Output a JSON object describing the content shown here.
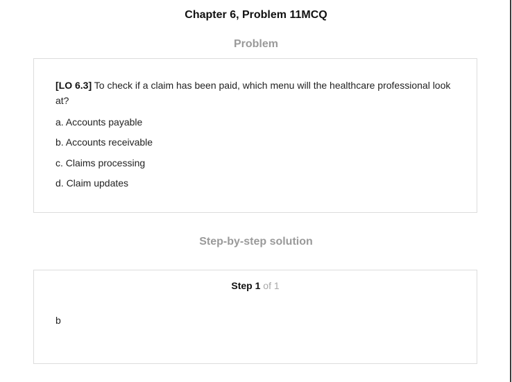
{
  "header": {
    "title": "Chapter 6, Problem 11MCQ"
  },
  "problem": {
    "heading": "Problem",
    "lo_tag": "[LO 6.3]",
    "question_text": " To check if a claim has been paid, which menu will the healthcare professional look at?",
    "options": [
      "a. Accounts payable",
      "b. Accounts receivable",
      "c. Claims processing",
      "d. Claim updates"
    ]
  },
  "solution": {
    "heading": "Step-by-step solution",
    "step_word": "Step",
    "step_number": "1",
    "step_of": "of 1",
    "answer": "b"
  }
}
